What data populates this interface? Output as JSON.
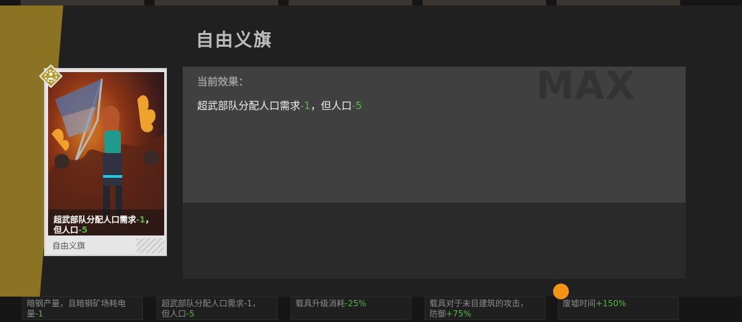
{
  "panel": {
    "title": "自由义旗",
    "max_label": "MAX",
    "effect_heading": "当前效果：",
    "effect": {
      "text_before": "超武部队分配人口需求",
      "value1": "-1",
      "text_mid": "，但人口",
      "value2": "-5"
    }
  },
  "card": {
    "caption": {
      "text_before": "超武部队分配人口需求",
      "value1": "-1",
      "text_mid": "，",
      "text_line2": "但人口",
      "value2": "-5"
    },
    "name": "自由义旗",
    "badge_icon": "gear-person-icon"
  },
  "background_cards": [
    {
      "line1": "暗钢产量，且暗钢矿场耗电",
      "line2": "量",
      "value": "-1"
    },
    {
      "line1": "超武部队分配人口需求-1，",
      "line2": "但人口",
      "value": "-5"
    },
    {
      "line1": "",
      "line2": "载具升级消耗",
      "value": "-25%"
    },
    {
      "line1": "载具对于未目建筑的攻击，",
      "line2": "防御",
      "value": "+75%"
    },
    {
      "line1": "",
      "line2": "废墟时间",
      "value": "+150%"
    }
  ],
  "colors": {
    "accent_gold": "#8a7423",
    "positive_green": "#5ab54a",
    "indicator_orange": "#f39417"
  }
}
